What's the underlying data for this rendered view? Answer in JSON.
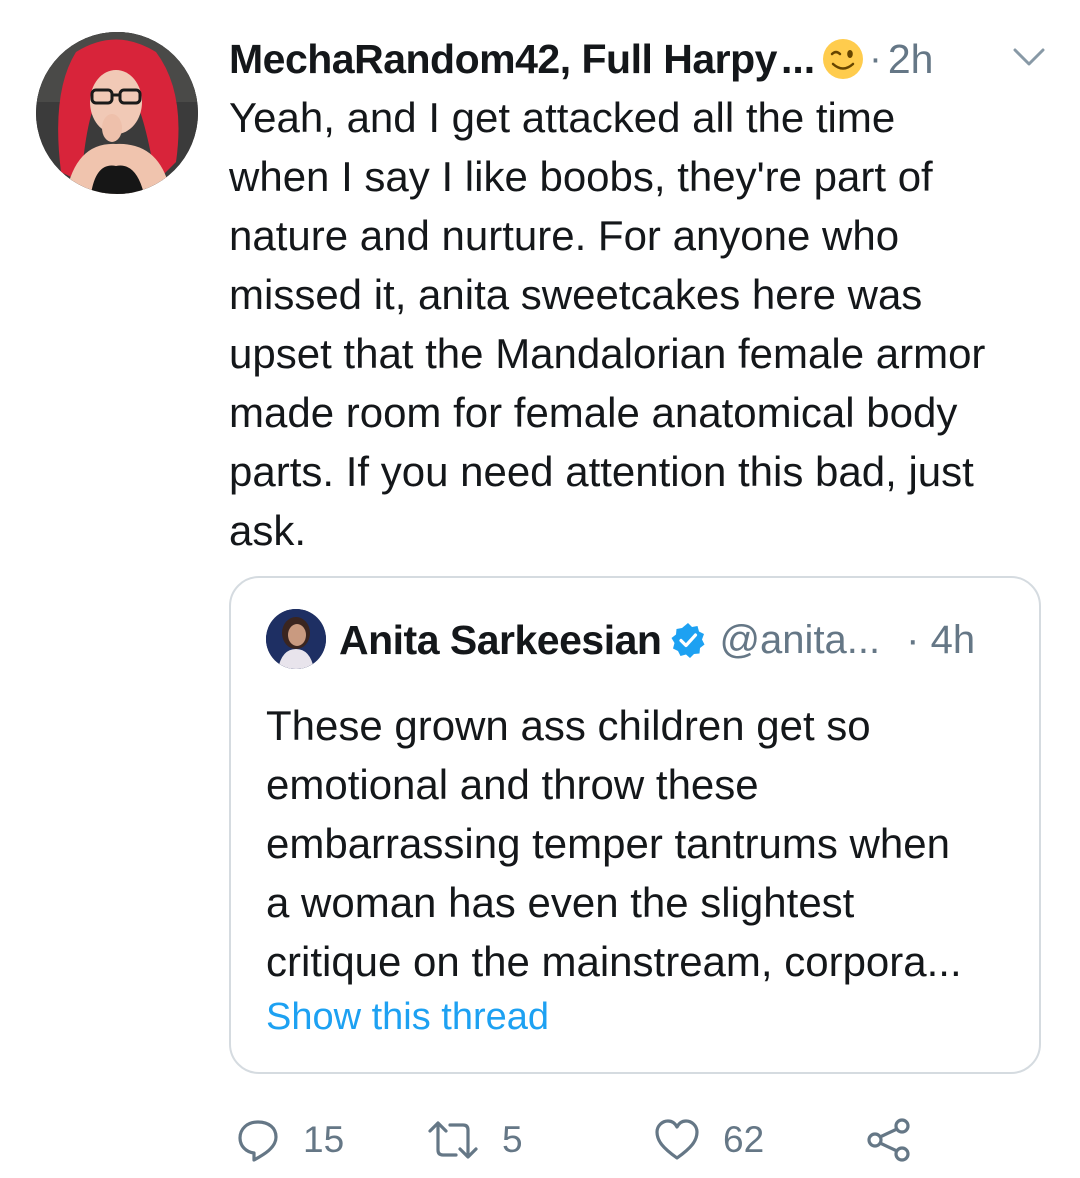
{
  "tweet": {
    "display_name": "MechaRandom42, Full Harpy",
    "name_ellipsis": "...",
    "emoji_icon": "winking-face-icon",
    "separator": "·",
    "time": "2h",
    "menu_icon": "chevron-down-icon",
    "text": "Yeah, and I get attacked all the time\nwhen I say I like boobs, they're part of\nnature and nurture. For anyone who\nmissed it, anita sweetcakes here was\nupset that the Mandalorian female armor\nmade room for female anatomical body\nparts. If you need attention this bad, just\nask."
  },
  "quoted_tweet": {
    "name": "Anita Sarkeesian",
    "verified_icon": "verified-badge-icon",
    "handle": "@anita...",
    "time": "· 4h",
    "text": "These grown ass children get so\nemotional and throw these\nembarrassing temper tantrums when\na woman has even the slightest\ncritique on the mainstream, corpora...",
    "show_thread": "Show this thread"
  },
  "actions": {
    "reply": {
      "icon": "reply-icon",
      "count": "15"
    },
    "retweet": {
      "icon": "retweet-icon",
      "count": "5"
    },
    "like": {
      "icon": "heart-icon",
      "count": "62"
    },
    "share": {
      "icon": "share-icon"
    }
  },
  "colors": {
    "text": "#14171a",
    "secondary": "#657786",
    "link": "#1da1f2",
    "border": "#d5dbe0"
  }
}
